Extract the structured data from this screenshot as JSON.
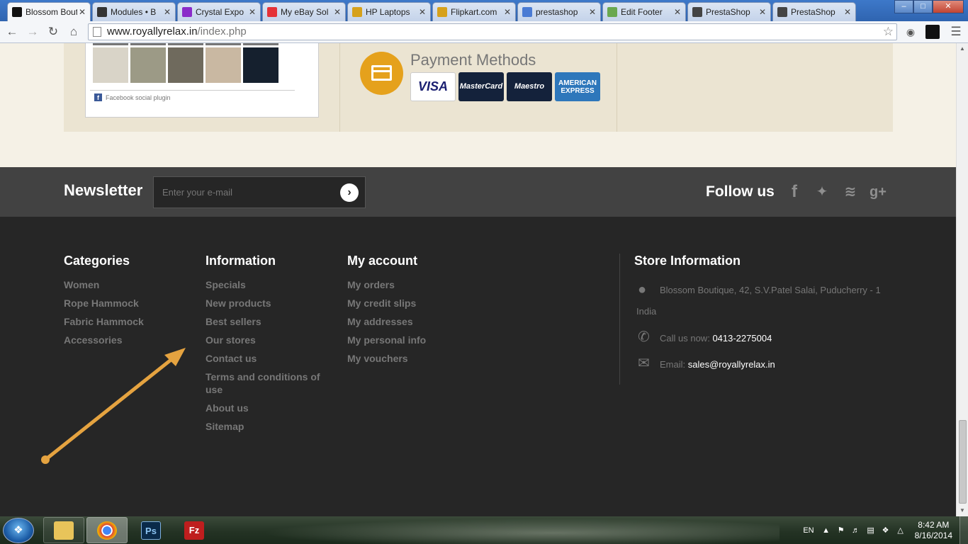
{
  "browser": {
    "tabs": [
      {
        "title": "Blossom Boutique",
        "icon": "page-icon",
        "color": "#111111",
        "active": true
      },
      {
        "title": "Modules • B",
        "icon": "page-icon",
        "color": "#333333"
      },
      {
        "title": "Crystal Expo",
        "icon": "c-icon",
        "color": "#8a2bc9"
      },
      {
        "title": "My eBay Sol",
        "icon": "ebay-icon",
        "color": "#e53238"
      },
      {
        "title": "HP Laptops",
        "icon": "flipkart-icon",
        "color": "#d6a11b"
      },
      {
        "title": "Flipkart.com",
        "icon": "flipkart-icon",
        "color": "#d6a11b"
      },
      {
        "title": "prestashop",
        "icon": "google-icon",
        "color": "#4a7bd4"
      },
      {
        "title": "Edit Footer",
        "icon": "leaf-icon",
        "color": "#6aa84f"
      },
      {
        "title": "PrestaShop",
        "icon": "page-icon",
        "color": "#444444"
      },
      {
        "title": "PrestaShop",
        "icon": "page-icon",
        "color": "#444444"
      }
    ],
    "url_host": "www.royallyrelax.in",
    "url_path": "/index.php"
  },
  "facebook": {
    "plugin_label": "Facebook social plugin"
  },
  "payment": {
    "title": "Payment Methods",
    "cards": [
      "VISA",
      "MasterCard",
      "Maestro",
      "AMERICAN EXPRESS"
    ]
  },
  "newsletter": {
    "title": "Newsletter",
    "placeholder": "Enter your e-mail",
    "follow_title": "Follow us",
    "social_icons": [
      "facebook-icon",
      "twitter-icon",
      "rss-icon",
      "google-plus-icon"
    ]
  },
  "footer": {
    "categories": {
      "title": "Categories",
      "items": [
        "Women",
        "Rope Hammock",
        "Fabric Hammock",
        "Accessories"
      ]
    },
    "information": {
      "title": "Information",
      "items": [
        "Specials",
        "New products",
        "Best sellers",
        "Our stores",
        "Contact us",
        "Terms and conditions of use",
        "About us",
        "Sitemap"
      ]
    },
    "account": {
      "title": "My account",
      "items": [
        "My orders",
        "My credit slips",
        "My addresses",
        "My personal info",
        "My vouchers"
      ]
    },
    "store": {
      "title": "Store Information",
      "address": "Blossom Boutique, 42, S.V.Patel Salai, Puducherry - 1",
      "country": "India",
      "call_label": "Call us now:",
      "phone": "0413-2275004",
      "email_label": "Email:",
      "email": "sales@royallyrelax.in"
    }
  },
  "annotation": {
    "arrow_color": "#e5a340"
  },
  "taskbar": {
    "language": "EN",
    "time": "8:42 AM",
    "date": "8/16/2014"
  }
}
